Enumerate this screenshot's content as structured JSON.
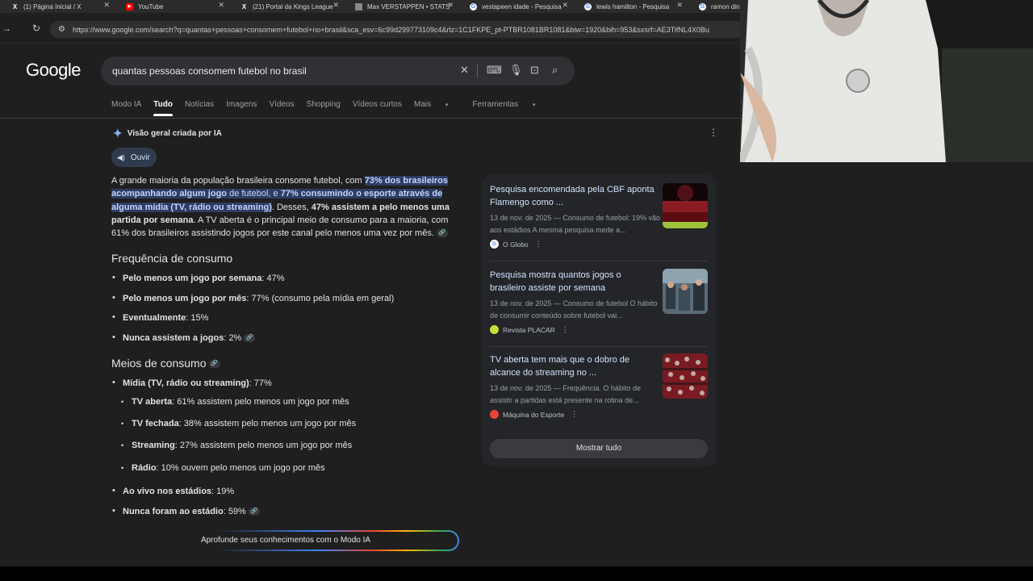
{
  "browser": {
    "tabs": [
      {
        "title": "(1) Página Inicial / X",
        "icon": "x-logo-icon"
      },
      {
        "title": "YouTube",
        "icon": "youtube-icon"
      },
      {
        "title": "(21) Portal da Kings League",
        "icon": "x-logo-icon"
      },
      {
        "title": "Max VERSTAPPEN • STATS",
        "icon": "image-icon"
      },
      {
        "title": "vestapeen idade - Pesquisa",
        "icon": "google-icon"
      },
      {
        "title": "lewis hamilton - Pesquisa",
        "icon": "google-icon"
      },
      {
        "title": "ramon dino",
        "icon": "google-icon"
      }
    ],
    "url": "https://www.google.com/search?q=quantas+pessoas+consomem+futebol+no+brasil&sca_esv=6c99d299773109c4&rlz=1C1FKPE_pt-PTBR1081BR1081&biw=1920&bih=953&sxsrf=AE3TifNL4X0Bu"
  },
  "google": {
    "logo": "Google",
    "query": "quantas pessoas consomem futebol no brasil",
    "tabs": [
      "Modo IA",
      "Tudo",
      "Notícias",
      "Imagens",
      "Vídeos",
      "Shopping",
      "Vídeos curtos",
      "Mais",
      "Ferramentas"
    ]
  },
  "ai": {
    "header": "Visão geral criada por IA",
    "listen": "Ouvir",
    "intro": {
      "t1": "A grande maioria da população brasileira consome futebol, com ",
      "h1": "73% dos brasileiros acompanhando algum jogo",
      "t2": " de futebol, e ",
      "h2": "77% consumindo o esporte através de alguma mídia (TV, rádio ou streaming)",
      "t3": ". Desses, ",
      "b1": "47% assistem a pelo menos uma partida por semana",
      "t4": ". A TV aberta é o principal meio de consumo para a maioria, com 61% dos brasileiros assistindo jogos por este canal pelo menos uma vez por mês."
    },
    "freq_title": "Frequência de consumo",
    "freq": [
      {
        "b": "Pelo menos um jogo por semana",
        "t": ": 47%"
      },
      {
        "b": "Pelo menos um jogo por mês",
        "t": ": 77% (consumo pela mídia em geral)"
      },
      {
        "b": "Eventualmente",
        "t": ": 15%"
      },
      {
        "b": "Nunca assistem a jogos",
        "t": ": 2%"
      }
    ],
    "means_title": "Meios de consumo",
    "media": {
      "b": "Mídia (TV, rádio ou streaming)",
      "t": ": 77%"
    },
    "media_sub": [
      {
        "b": "TV aberta",
        "t": ": 61% assistem pelo menos um jogo por mês"
      },
      {
        "b": "TV fechada",
        "t": ": 38% assistem pelo menos um jogo por mês"
      },
      {
        "b": "Streaming",
        "t": ": 27% assistem pelo menos um jogo por mês"
      },
      {
        "b": "Rádio",
        "t": ": 10% ouvem pelo menos um jogo por mês"
      }
    ],
    "stadium": [
      {
        "b": "Ao vivo nos estádios",
        "t": ": 19%"
      },
      {
        "b": "Nunca foram ao estádio",
        "t": ": 59%"
      }
    ],
    "deep_dive": "Aprofunde seus conhecimentos com o Modo IA"
  },
  "sources": [
    {
      "title": "Pesquisa encomendada pela CBF aponta Flamengo como ...",
      "snippet": "13 de nov. de 2025 — Consumo de futebol: 19% vão aos estádios A mesma pesquisa mede a...",
      "site": "O Globo",
      "fav": "G",
      "fav_color": "#4285f4"
    },
    {
      "title": "Pesquisa mostra quantos jogos o brasileiro assiste por semana",
      "snippet": "13 de nov. de 2025 — Consumo de futebol O hábito de consumir conteúdo sobre futebol vai...",
      "site": "Revista PLACAR",
      "fav": "",
      "fav_color": "#c5e03a"
    },
    {
      "title": "TV aberta tem mais que o dobro de alcance do streaming no ...",
      "snippet": "13 de nov. de 2025 — Frequência. O hábito de assistir a partidas está presente na rotina de...",
      "site": "Máquina do Esporte",
      "fav": "",
      "fav_color": "#e8453c"
    }
  ],
  "show_all": "Mostrar tudo",
  "colors": {
    "background": "#1f1f1f",
    "highlight": "#2f3c63",
    "link": "#d2e3fc",
    "accent": "#8ab4f8"
  }
}
